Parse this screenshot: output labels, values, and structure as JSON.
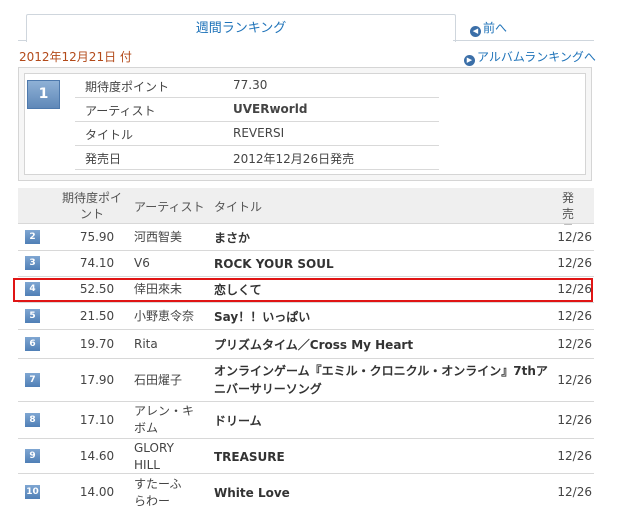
{
  "tabs": {
    "weekly_ranking": "週間ランキング",
    "prev": "前へ"
  },
  "date_label": "2012年12月21日 付",
  "album_ranking_link": "アルバムランキングへ",
  "top": {
    "rank": "1",
    "rows": [
      {
        "label": "期待度ポイント",
        "value": "77.30"
      },
      {
        "label": "アーティスト",
        "value": "UVERworld"
      },
      {
        "label": "タイトル",
        "value": "REVERSI"
      },
      {
        "label": "発売日",
        "value": "2012年12月26日発売"
      }
    ]
  },
  "table_header": {
    "points": "期待度ポイント",
    "artist": "アーティスト",
    "title": "タイトル",
    "release": "発売日"
  },
  "rows": [
    {
      "rank": "2",
      "points": "75.90",
      "artist": "河西智美",
      "title": "まさか",
      "release": "12/26"
    },
    {
      "rank": "3",
      "points": "74.10",
      "artist": "V6",
      "title": "ROCK YOUR SOUL",
      "release": "12/26"
    },
    {
      "rank": "4",
      "points": "52.50",
      "artist": "倖田來未",
      "title": "恋しくて",
      "release": "12/26"
    },
    {
      "rank": "5",
      "points": "21.50",
      "artist": "小野恵令奈",
      "title": "Say！！いっぱい",
      "release": "12/26"
    },
    {
      "rank": "6",
      "points": "19.70",
      "artist": "Rita",
      "title": "プリズムタイム／Cross My Heart",
      "release": "12/26"
    },
    {
      "rank": "7",
      "points": "17.90",
      "artist": "石田燿子",
      "title": "オンラインゲーム『エミル・クロニクル・オンライン』7thアニバーサリーソング",
      "release": "12/26"
    },
    {
      "rank": "8",
      "points": "17.10",
      "artist": "アレン・キボム",
      "title": "ドリーム",
      "release": "12/26"
    },
    {
      "rank": "9",
      "points": "14.60",
      "artist": "GLORY HILL",
      "title": "TREASURE",
      "release": "12/26"
    },
    {
      "rank": "10",
      "points": "14.00",
      "artist": "すたーふらわー",
      "title": "White Love",
      "release": "12/26"
    }
  ]
}
